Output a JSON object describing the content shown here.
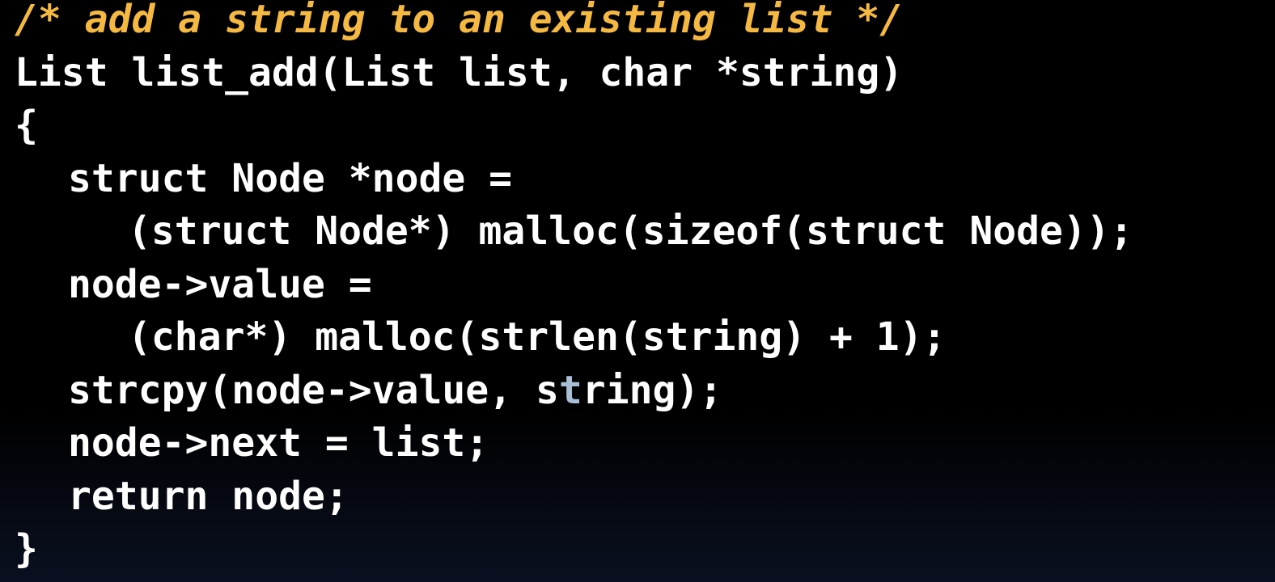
{
  "code": {
    "comment": "/* add a string to an existing list */",
    "signature": "List list_add(List list, char *string)",
    "open_brace": "{",
    "decl_node": "struct Node *node =",
    "malloc_node": "(struct Node*) malloc(sizeof(struct Node));",
    "assign_value": "node->value =",
    "malloc_value": "(char*) malloc(strlen(string) + 1);",
    "strcpy_pre": "strcpy(node->value, s",
    "strcpy_hl": "t",
    "strcpy_post": "ring);",
    "assign_next": "node->next = list;",
    "return_stmt": "return node;",
    "close_brace": "}"
  },
  "colors": {
    "background": "#000000",
    "code_text": "#ffffff",
    "comment": "#f5b942",
    "cursor_highlight": "#a9bfd6"
  }
}
